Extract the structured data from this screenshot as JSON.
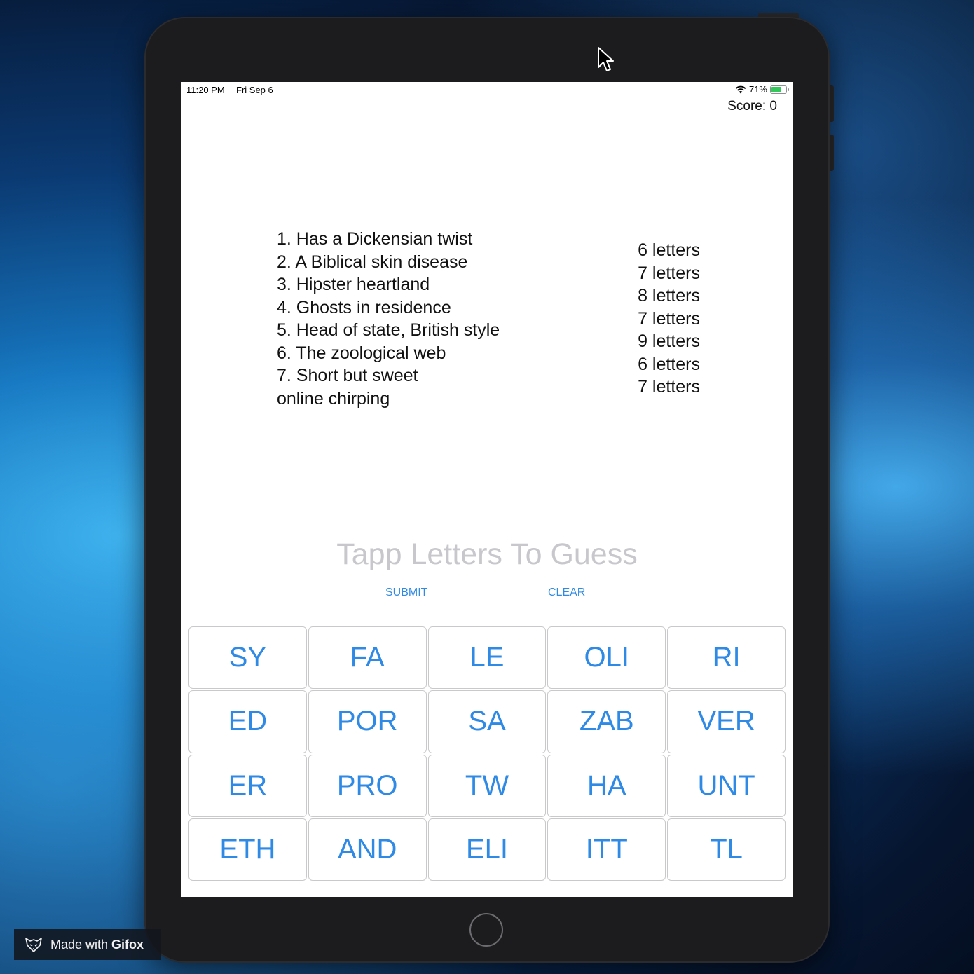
{
  "status_bar": {
    "time": "11:20 PM",
    "date": "Fri Sep 6",
    "battery_percent": "71%",
    "battery_level": 0.71,
    "icons": [
      "wifi-icon",
      "battery-charging-icon"
    ]
  },
  "score_label": "Score: 0",
  "clues": [
    "1. Has a Dickensian twist",
    "2. A Biblical skin disease",
    "3. Hipster heartland",
    "4. Ghosts in residence",
    "5. Head of state, British style",
    "6. The zoological web",
    "7. Short but sweet",
    "online chirping"
  ],
  "lengths": [
    "6 letters",
    "7 letters",
    "8 letters",
    "7 letters",
    "9 letters",
    "6 letters",
    "7 letters"
  ],
  "guess_placeholder": "Tapp Letters To Guess",
  "actions": {
    "submit": "SUBMIT",
    "clear": "CLEAR"
  },
  "tiles": [
    "SY",
    "FA",
    "LE",
    "OLI",
    "RI",
    "ED",
    "POR",
    "SA",
    "ZAB",
    "VER",
    "ER",
    "PRO",
    "TW",
    "HA",
    "UNT",
    "ETH",
    "AND",
    "ELI",
    "ITT",
    "TL"
  ],
  "watermark": {
    "prefix": "Made with ",
    "brand": "Gifox",
    "icon": "fox-logo-icon"
  },
  "colors": {
    "accent": "#2f8ae5",
    "placeholder": "#c8c8cc",
    "battery": "#34c759"
  }
}
